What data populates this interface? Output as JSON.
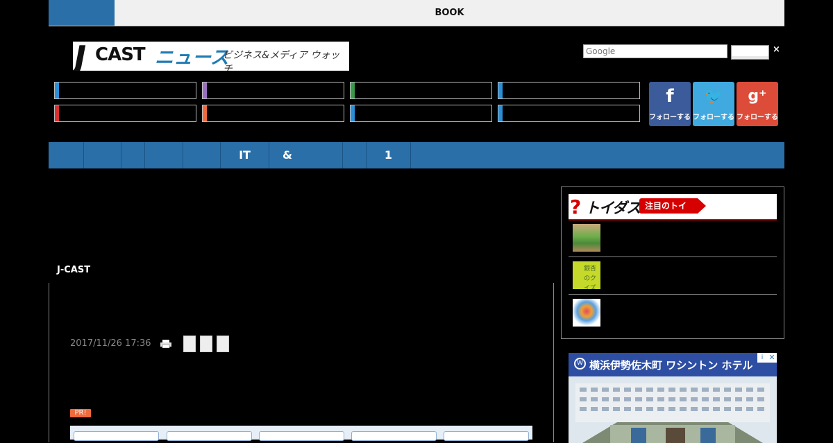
{
  "topbar": {
    "book_label": "BOOK"
  },
  "logo": {
    "j": "J",
    "cast": "CAST",
    "news": "ニュース",
    "tagline": "ビジネス&メディア ウォッチ"
  },
  "search": {
    "placeholder": "Google",
    "clear_label": "×"
  },
  "categories": {
    "stripe_colors": [
      "#2a8fd6",
      "#9a6fc0",
      "#3a9a4a",
      "#2a8fd6",
      "#d63030",
      "#ef6a3c",
      "#2a8fd6",
      "#2a8fd6"
    ]
  },
  "social": [
    {
      "icon": "facebook-icon",
      "glyph": "f",
      "label": "フォローする",
      "color": "#3b5b9a"
    },
    {
      "icon": "twitter-icon",
      "glyph": "🐦",
      "label": "フォローする",
      "color": "#3fa9e0"
    },
    {
      "icon": "googleplus-icon",
      "glyph": "g⁺",
      "label": "フォローする",
      "color": "#dd4b39"
    }
  ],
  "nav": {
    "items": [
      "",
      "",
      "",
      "",
      "",
      "IT",
      "&",
      "",
      "1"
    ]
  },
  "article": {
    "section_label": "J-CAST",
    "date": "2017/11/26 17:36",
    "pr_badge": "PR!"
  },
  "sidebar": {
    "toidas_logo": "トイダス",
    "toidas_tag": "注目のトイ",
    "thumb_text": "銀杏のクイズ"
  },
  "ad": {
    "title": "横浜伊勢佐木町 ワシントン ホテル",
    "choices": "i",
    "close": "✕"
  }
}
